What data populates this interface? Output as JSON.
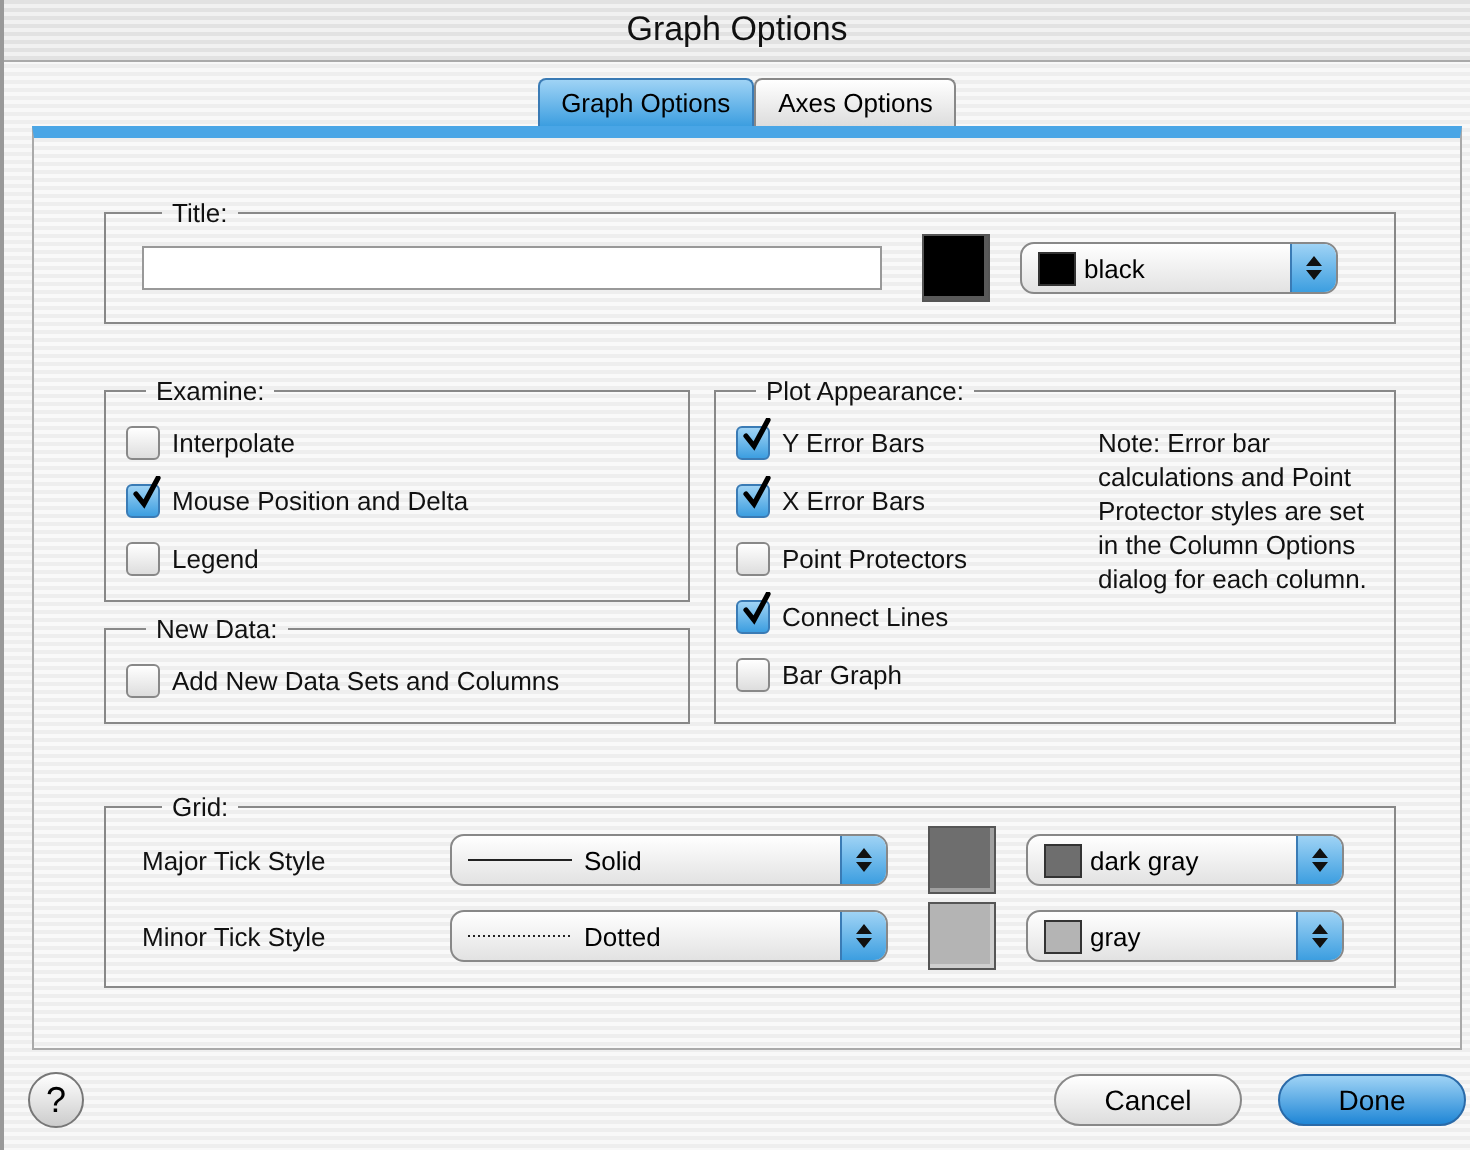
{
  "window": {
    "title": "Graph Options"
  },
  "tabs": [
    {
      "label": "Graph Options",
      "selected": true
    },
    {
      "label": "Axes Options",
      "selected": false
    }
  ],
  "title_group": {
    "label": "Title:",
    "color": "#000000",
    "color_name": "black"
  },
  "examine": {
    "label": "Examine:",
    "options": [
      {
        "label": "Interpolate",
        "checked": false
      },
      {
        "label": "Mouse Position and Delta",
        "checked": true
      },
      {
        "label": "Legend",
        "checked": false
      }
    ]
  },
  "new_data": {
    "label": "New Data:",
    "options": [
      {
        "label": "Add New Data Sets and Columns",
        "checked": false
      }
    ]
  },
  "plot_appearance": {
    "label": "Plot Appearance:",
    "options": [
      {
        "label": "Y Error Bars",
        "checked": true
      },
      {
        "label": "X Error Bars",
        "checked": true
      },
      {
        "label": "Point Protectors",
        "checked": false
      },
      {
        "label": "Connect Lines",
        "checked": true
      },
      {
        "label": "Bar Graph",
        "checked": false
      }
    ],
    "note": "Note: Error bar calculations and Point Protector styles are set in the Column Options dialog for each column."
  },
  "grid": {
    "label": "Grid:",
    "rows": [
      {
        "label": "Major Tick Style",
        "style": {
          "kind": "solid",
          "label": "Solid"
        },
        "color": "#6e6e6e",
        "color_name": "dark gray"
      },
      {
        "label": "Minor Tick Style",
        "style": {
          "kind": "dotted",
          "label": "Dotted"
        },
        "color": "#b4b4b4",
        "color_name": "gray"
      }
    ]
  },
  "help": {
    "label": "?"
  },
  "buttons": [
    {
      "label": "Cancel",
      "default": false
    },
    {
      "label": "Done",
      "default": true
    }
  ]
}
